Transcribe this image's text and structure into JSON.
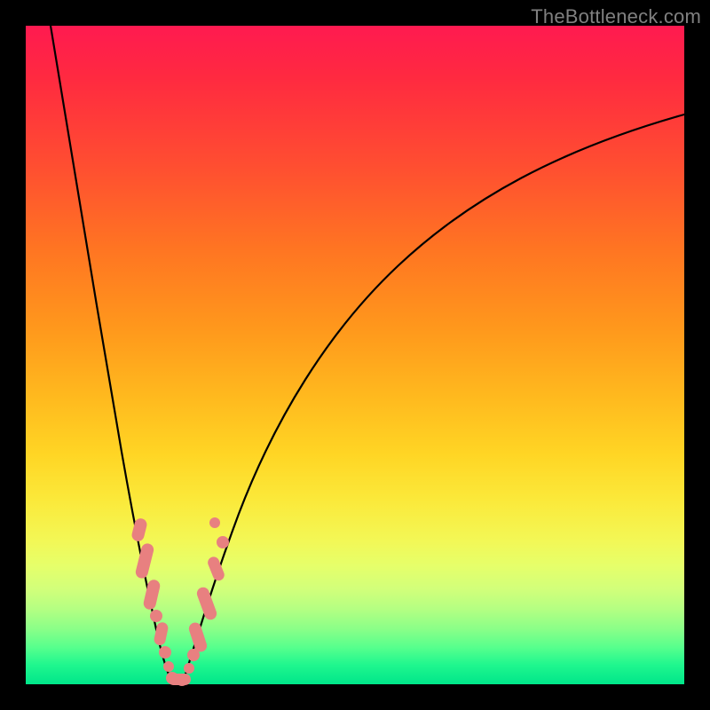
{
  "watermark": "TheBottleneck.com",
  "colors": {
    "frame": "#000000",
    "curve": "#000000",
    "marker": "#e88080",
    "gradient_top": "#ff1a50",
    "gradient_bottom": "#00e68a"
  },
  "chart_data": {
    "type": "line",
    "title": "",
    "xlabel": "",
    "ylabel": "",
    "xlim": [
      0,
      100
    ],
    "ylim": [
      0,
      100
    ],
    "notes": "V-shaped bottleneck curve; y is bottleneck percentage (0 = good/green, 100 = bad/red). Minimum at x≈21. No numeric axis ticks are shown; values estimated from pixel positions.",
    "series": [
      {
        "name": "bottleneck-curve",
        "x": [
          0,
          3,
          6,
          9,
          12,
          15,
          17,
          19,
          20,
          21,
          22,
          23,
          25,
          28,
          32,
          38,
          45,
          55,
          65,
          78,
          90,
          100
        ],
        "y": [
          100,
          86,
          72,
          58,
          44,
          30,
          18,
          8,
          3,
          0,
          2,
          5,
          11,
          20,
          31,
          44,
          56,
          67,
          74,
          80,
          84,
          86
        ]
      }
    ],
    "markers": {
      "name": "highlighted-points",
      "comment": "Pink/salmon dots and pill segments near the trough of the V",
      "x": [
        15.5,
        16.2,
        16.8,
        17.3,
        17.8,
        18.5,
        19.2,
        19.8,
        20.4,
        21.0,
        21.8,
        22.5,
        23.0,
        23.6,
        24.3,
        25.0,
        25.8,
        26.7
      ],
      "y": [
        27,
        24,
        21,
        18,
        15,
        11,
        7,
        4,
        2,
        0,
        1,
        3,
        5,
        7,
        10,
        13,
        16,
        20
      ]
    }
  }
}
